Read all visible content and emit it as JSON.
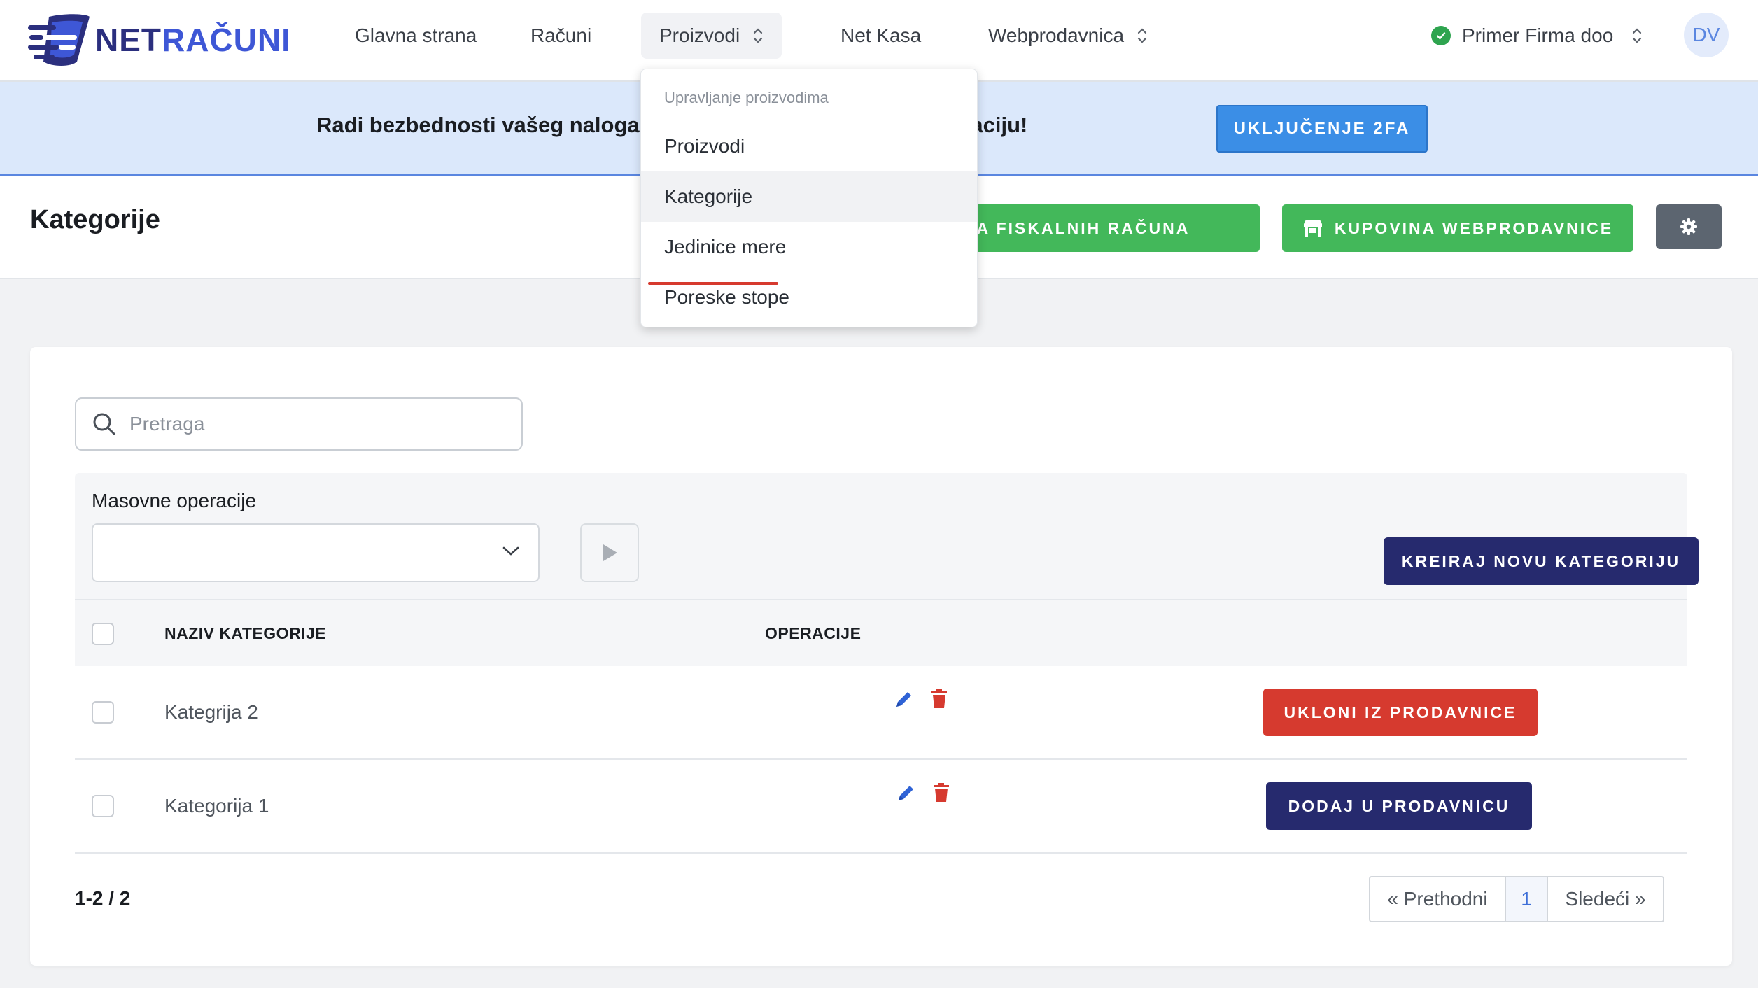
{
  "brand": {
    "net": "NET",
    "racuni": "RAČUNI"
  },
  "nav": {
    "home": "Glavna strana",
    "invoices": "Računi",
    "products": "Proizvodi",
    "net_kasa": "Net Kasa",
    "webshop": "Webprodavnica",
    "company": "Primer Firma doo",
    "avatar": "DV"
  },
  "products_menu": {
    "header": "Upravljanje proizvodima",
    "items": [
      "Proizvodi",
      "Kategorije",
      "Jedinice mere",
      "Poreske stope"
    ],
    "highlighted": "Kategorije"
  },
  "banner": {
    "text": "Radi bezbednosti vašeg naloga, uključite dvofaktorsku autentikaciju!",
    "button": "UKLJUČENJE 2FA"
  },
  "page": {
    "title": "Kategorije",
    "buy_fiscal": "KUPOVINA FISKALNIH RAČUNA",
    "buy_webshop": "KUPOVINA WEBPRODAVNICE"
  },
  "search": {
    "placeholder": "Pretraga"
  },
  "bulk": {
    "label": "Masovne operacije",
    "create_button": "KREIRAJ NOVU KATEGORIJU"
  },
  "table": {
    "headers": {
      "name": "NAZIV KATEGORIJE",
      "operations": "OPERACIJE"
    },
    "rows": [
      {
        "name": "Kategrija 2",
        "action": "UKLONI IZ PRODAVNICE"
      },
      {
        "name": "Kategorija 1",
        "action": "DODAJ U PRODAVNICU"
      }
    ]
  },
  "pagination": {
    "count": "1-2 / 2",
    "prev": "« Prethodni",
    "current": "1",
    "next": "Sledeći »"
  },
  "colors": {
    "navy": "#262a6e",
    "red": "#d63a2f",
    "green": "#43b85a",
    "blue": "#3b8ee6",
    "banner_bg": "#dbe8fb"
  }
}
